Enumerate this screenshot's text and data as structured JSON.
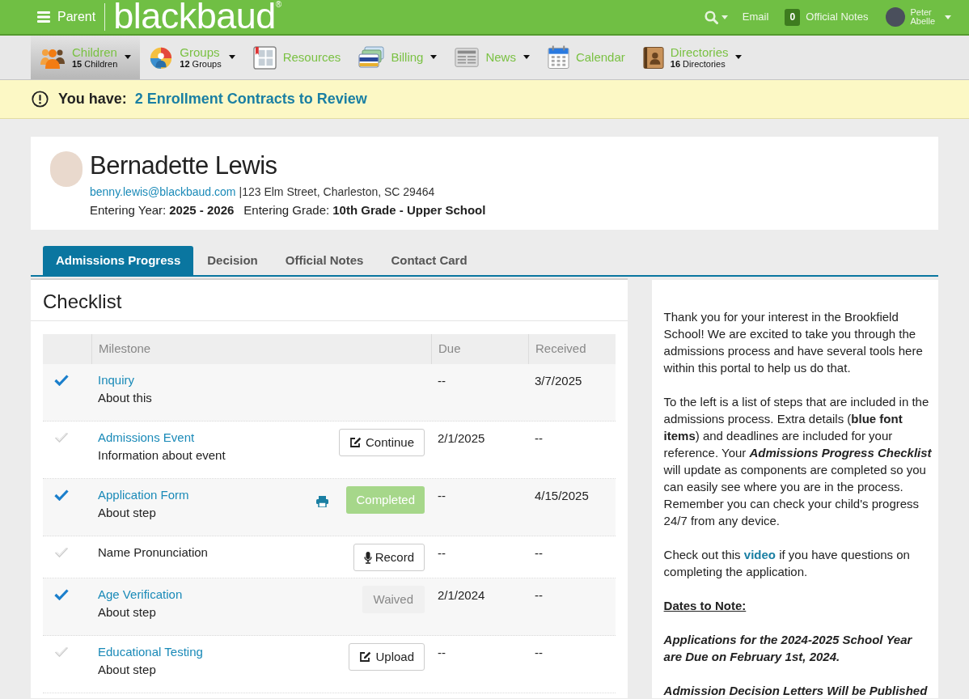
{
  "top_bar": {
    "menu_label": "Parent",
    "logo": "blackbaud$^{®}$",
    "email_label": "Email",
    "notes_count": "0",
    "notes_label": "Official Notes",
    "user_name": [
      "Peter",
      "Abelle"
    ]
  },
  "nav_items": [
    {
      "label": "Children",
      "count": "15",
      "count_label": "Children",
      "dropdown": true,
      "selected": true
    },
    {
      "label": "Groups",
      "count": "12",
      "count_label": "Groups",
      "dropdown": true,
      "selected": false
    },
    {
      "label": "Resources",
      "dropdown": false,
      "selected": false
    },
    {
      "label": "Billing",
      "dropdown": true,
      "selected": false
    },
    {
      "label": "News",
      "dropdown": true,
      "selected": false
    },
    {
      "label": "Calendar",
      "dropdown": false,
      "selected": false
    },
    {
      "label": "Directories",
      "count": "16",
      "count_label": "Directories",
      "dropdown": true,
      "selected": false
    }
  ],
  "alert": {
    "prefix": "You have:",
    "link": "2 Enrollment Contracts to Review"
  },
  "profile": {
    "name": "Bernadette Lewis",
    "email": "benny.lewis@blackbaud.com",
    "address": "|123 Elm Street, Charleston, SC 29464",
    "year_label": "Entering Year:",
    "year": "2025 - 2026",
    "grade_label": "Entering Grade:",
    "grade": "10th Grade - Upper School"
  },
  "tabs": [
    {
      "label": "Admissions Progress",
      "selected": true
    },
    {
      "label": "Decision",
      "selected": false
    },
    {
      "label": "Official Notes",
      "selected": false
    },
    {
      "label": "Contact Card",
      "selected": false
    }
  ],
  "checklist": {
    "title": "Checklist",
    "columns": [
      "Milestone",
      "Due",
      "Received"
    ],
    "rows": [
      {
        "done": true,
        "title": "Inquiry",
        "link": true,
        "subtitle": "About this",
        "printable": false,
        "due": "--",
        "received": "3/7/2025"
      },
      {
        "done": false,
        "title": "Admissions Event",
        "link": true,
        "subtitle": "Information about event",
        "printable": false,
        "action": {
          "kind": "edit",
          "label": "Continue"
        },
        "due": "2/1/2025",
        "received": "--"
      },
      {
        "done": true,
        "title": "Application Form",
        "link": true,
        "subtitle": "About step",
        "printable": true,
        "action": {
          "kind": "completed",
          "label": "Completed"
        },
        "due": "--",
        "received": "4/15/2025"
      },
      {
        "done": false,
        "title": "Name Pronunciation",
        "link": false,
        "printable": false,
        "action": {
          "kind": "record",
          "label": "Record"
        },
        "due": "--",
        "received": "--"
      },
      {
        "done": true,
        "title": "Age Verification",
        "link": true,
        "subtitle": "About step",
        "printable": false,
        "action": {
          "kind": "waived",
          "label": "Waived"
        },
        "due": "2/1/2024",
        "received": "--"
      },
      {
        "done": false,
        "title": "Educational Testing",
        "link": true,
        "subtitle": "About step",
        "printable": false,
        "action": {
          "kind": "edit",
          "label": "Upload"
        },
        "due": "--",
        "received": "--"
      }
    ]
  },
  "info_panel": {
    "paragraphs": [
      {
        "kind": "text",
        "parts": [
          {
            "kind": "plain",
            "text": "Thank you for your interest in the Brookfield School! We are excited to take you through the admissions process and have several tools here within this portal to help us do that."
          }
        ]
      },
      {
        "kind": "text",
        "parts": [
          {
            "kind": "plain",
            "text": "To the left is a list of steps that are included in the admissions process. Extra details (**blue font items**) and deadlines are included for your reference. Your "
          },
          {
            "kind": "emphasis",
            "text": "Admissions Progress Checklist"
          },
          {
            "kind": "plain",
            "text": " will update as components are completed so you can easily see where you are in the process. Remember you can check your child's progress 24/7 from any device."
          }
        ]
      },
      {
        "kind": "text",
        "parts": [
          {
            "kind": "plain",
            "text": "Check out this "
          },
          {
            "kind": "link",
            "text": "video"
          },
          {
            "kind": "plain",
            "text": " if you have questions on completing the application."
          }
        ]
      },
      {
        "kind": "heading",
        "parts": [
          {
            "kind": "plain",
            "text": "Dates to Note:"
          }
        ]
      },
      {
        "kind": "notice",
        "parts": [
          {
            "kind": "plain",
            "text": "Applications for the 2024-2025 School Year are Due on February 1st, 2024."
          }
        ]
      },
      {
        "kind": "notice",
        "parts": [
          {
            "kind": "plain",
            "text": "Admission Decision Letters Will be Published"
          }
        ]
      }
    ]
  }
}
